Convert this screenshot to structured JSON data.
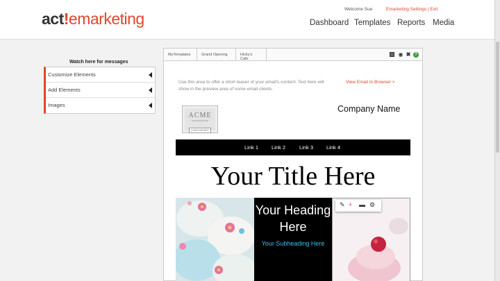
{
  "header": {
    "logo": {
      "part1": "act",
      "part2": "!",
      "part3": "emarketing"
    },
    "welcome": "Welcome Sue",
    "settings_link": "Emarketing Settings | Exit",
    "nav": [
      "Dashboard",
      "Templates",
      "Reports",
      "Media"
    ]
  },
  "sidebar": {
    "title": "Watch here for messages",
    "items": [
      {
        "label": "Customize Elements"
      },
      {
        "label": "Add Elements"
      },
      {
        "label": "Images"
      }
    ]
  },
  "editor": {
    "breadcrumbs": [
      "MyTemplates",
      "Grand Opening",
      "Hicky's Cafe"
    ],
    "toolbar_icons": [
      "save-icon",
      "preview-eye-icon",
      "close-icon",
      "help-icon"
    ],
    "help_glyph": "?",
    "teaser": "Use this area to offer a short teaser of your email's content. Text here will show in the preview area of some email clients.",
    "view_link": "View Email In Browser >",
    "logo": {
      "name": "ACME",
      "sub": "INCORPORATED",
      "box": "LOGO SOCKET"
    },
    "company": "Company Name",
    "links": [
      "Link 1",
      "Link 2",
      "Link 3",
      "Link 4"
    ],
    "title": "Your Title Here",
    "heading": "Your Heading Here",
    "subheading": "Your Subheading Here",
    "image_tools": [
      "pencil-icon",
      "add-icon",
      "eraser-icon",
      "gear-icon"
    ]
  },
  "colors": {
    "accent": "#e0452b",
    "subheading": "#3ec0e8",
    "help": "#3a9a3a"
  }
}
